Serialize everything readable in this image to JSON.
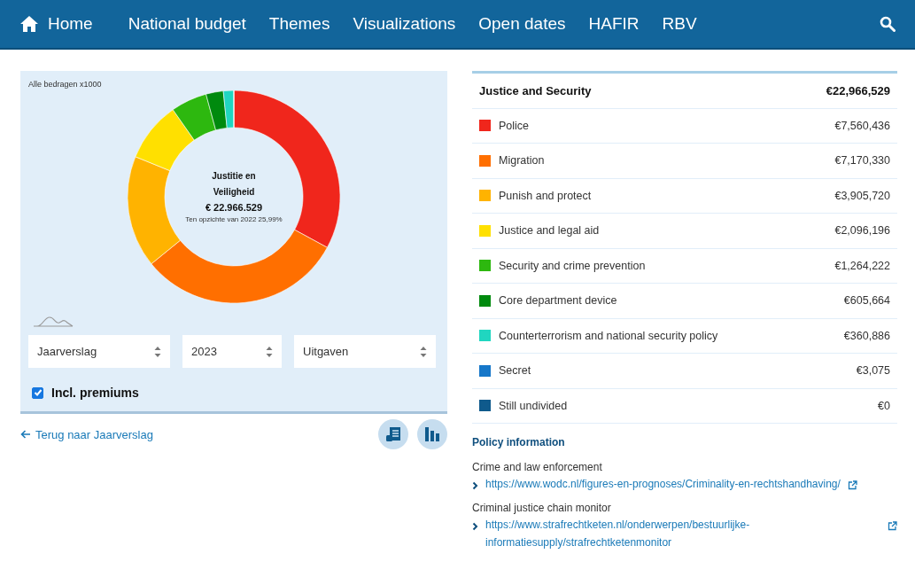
{
  "nav": {
    "items": [
      {
        "label": "Home",
        "kind": "home"
      },
      {
        "label": "National budget",
        "kind": "link"
      },
      {
        "label": "Themes",
        "kind": "link"
      },
      {
        "label": "Visualizations",
        "kind": "link"
      },
      {
        "label": "Open dates",
        "kind": "link"
      },
      {
        "label": "HAFIR",
        "kind": "link"
      },
      {
        "label": "RBV",
        "kind": "link"
      }
    ]
  },
  "chart_panel": {
    "note": "Alle bedragen x1000",
    "chart_data": {
      "type": "donut",
      "values": [
        32.92,
        31.22,
        17.01,
        9.13,
        5.5,
        2.64,
        1.57,
        0.01,
        0
      ]
    },
    "center": {
      "title": "Justitie en Veiligheid",
      "amount": "€ 22.966.529",
      "comparison": "Ten opzichte van 2022 25,99%"
    },
    "selects": [
      {
        "value": "Jaarverslag"
      },
      {
        "value": "2023"
      },
      {
        "value": "Uitgaven"
      }
    ],
    "checkbox": {
      "label": "Incl. premiums",
      "checked": true
    }
  },
  "back_link": "Terug naar Jaarverslag",
  "table": {
    "header": {
      "label": "Justice and Security",
      "amount": "€22,966,529"
    },
    "rows": [
      {
        "label": "Police",
        "amount": "€7,560,436",
        "color": "#f0261c"
      },
      {
        "label": "Migration",
        "amount": "€7,170,330",
        "color": "#ff6f00"
      },
      {
        "label": "Punish and protect",
        "amount": "€3,905,720",
        "color": "#ffb300"
      },
      {
        "label": "Justice and legal aid",
        "amount": "€2,096,196",
        "color": "#ffe000"
      },
      {
        "label": "Security and crime prevention",
        "amount": "€1,264,222",
        "color": "#2db80f"
      },
      {
        "label": "Core department device",
        "amount": "€605,664",
        "color": "#008a0e"
      },
      {
        "label": "Counterterrorism and national security policy",
        "amount": "€360,886",
        "color": "#20d6c0"
      },
      {
        "label": "Secret",
        "amount": "€3,075",
        "color": "#1677c9"
      },
      {
        "label": "Still undivided",
        "amount": "€0",
        "color": "#0f5a8c"
      }
    ]
  },
  "policy": {
    "title": "Policy information",
    "items": [
      {
        "label": "Crime and law enforcement",
        "url": "https://www.wodc.nl/figures-en-prognoses/Criminality-en-rechtshandhaving/"
      },
      {
        "label": "Criminal justice chain monitor",
        "url": "https://www.strafrechtketen.nl/onderwerpen/bestuurlijke-informatiesupply/strafrechtketenmonitor"
      }
    ]
  }
}
